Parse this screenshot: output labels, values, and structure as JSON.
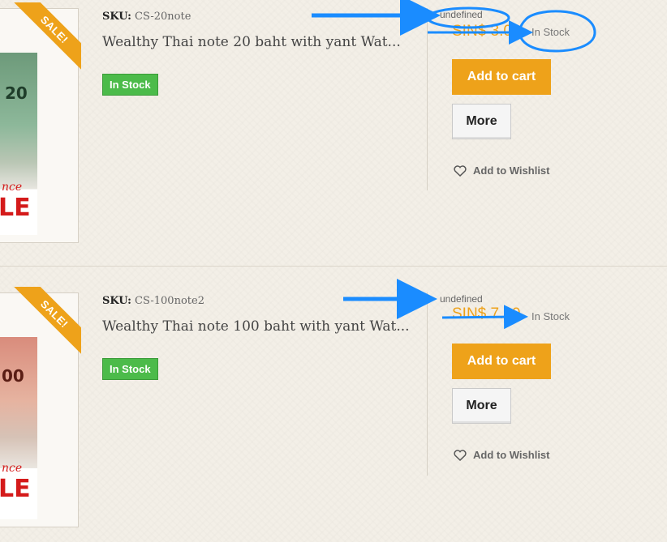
{
  "products": [
    {
      "sale_label": "SALE!",
      "sku_label": "SKU:",
      "sku": "CS-20note",
      "title": "Wealthy Thai note 20 baht with yant Wat...",
      "stock_badge": "In Stock",
      "variant_text": "undefined",
      "price": "SIN$ 3.00",
      "availability": "In Stock",
      "add_to_cart": "Add to cart",
      "more": "More",
      "wishlist": "Add to Wishlist",
      "thumb_number": "20",
      "thumb_sale_text": "nce",
      "thumb_big_text": "LE"
    },
    {
      "sale_label": "SALE!",
      "sku_label": "SKU:",
      "sku": "CS-100note2",
      "title": "Wealthy Thai note 100 baht with yant Wat...",
      "stock_badge": "In Stock",
      "variant_text": "undefined",
      "price": "SIN$ 7.00",
      "availability": "In Stock",
      "add_to_cart": "Add to cart",
      "more": "More",
      "wishlist": "Add to Wishlist",
      "thumb_number": "00",
      "thumb_sale_text": "nce",
      "thumb_big_text": "LE"
    }
  ],
  "colors": {
    "accent": "#eea21a",
    "stock_green": "#4cbb4a",
    "annotation_blue": "#1a8cff"
  },
  "icons": {
    "wishlist": "heart-icon"
  }
}
